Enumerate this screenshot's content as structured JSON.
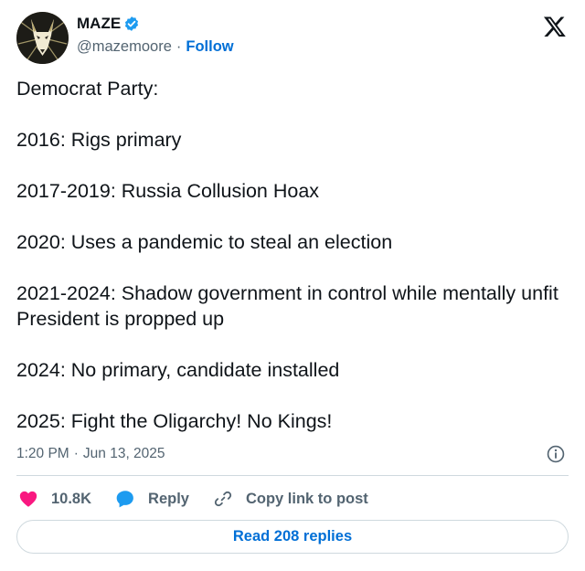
{
  "author": {
    "name": "MAZE",
    "handle": "@mazemoore",
    "separator": "·",
    "follow_label": "Follow",
    "verified": true,
    "verified_color": "#1d9bf0"
  },
  "platform_icon": "x-logo-icon",
  "tweet": {
    "paragraphs": [
      "Democrat Party:",
      "2016: Rigs primary",
      "2017-2019: Russia Collusion Hoax",
      "2020: Uses a pandemic to steal an election",
      "2021-2024: Shadow government in control while mentally unfit President is propped up",
      "2024: No primary, candidate installed",
      "2025: Fight the Oligarchy! No Kings!"
    ]
  },
  "meta": {
    "time": "1:20 PM",
    "separator": "·",
    "date": "Jun 13, 2025",
    "info_icon": "info-icon"
  },
  "actions": {
    "like_count": "10.8K",
    "like_icon": "heart-icon",
    "like_color": "#f91880",
    "reply_label": "Reply",
    "reply_icon": "speech-bubble-icon",
    "reply_color": "#1d9bf0",
    "copy_label": "Copy link to post",
    "copy_icon": "link-icon"
  },
  "read_replies_label": "Read 208 replies",
  "colors": {
    "text": "#0f1419",
    "secondary": "#536471",
    "link": "#006fd6",
    "border": "#cfd9de"
  }
}
